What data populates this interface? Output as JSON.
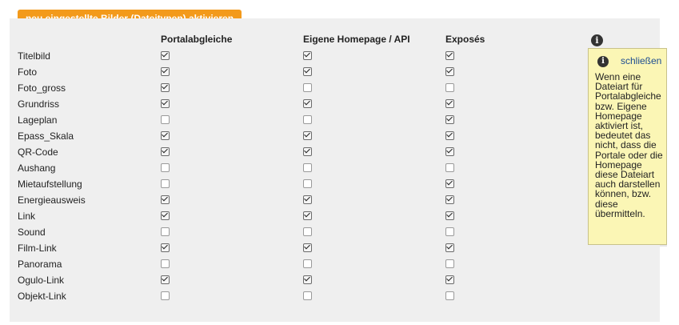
{
  "tab": {
    "label": "neu eingestellte Bilder (Dateitypen) aktivieren"
  },
  "columns": [
    "Portalabgleiche",
    "Eigene Homepage / API",
    "Exposés"
  ],
  "rows": [
    {
      "label": "Titelbild",
      "values": [
        true,
        true,
        true
      ]
    },
    {
      "label": "Foto",
      "values": [
        true,
        true,
        true
      ]
    },
    {
      "label": "Foto_gross",
      "values": [
        true,
        false,
        false
      ]
    },
    {
      "label": "Grundriss",
      "values": [
        true,
        true,
        true
      ]
    },
    {
      "label": "Lageplan",
      "values": [
        false,
        false,
        true
      ]
    },
    {
      "label": "Epass_Skala",
      "values": [
        true,
        true,
        true
      ]
    },
    {
      "label": "QR-Code",
      "values": [
        true,
        true,
        true
      ]
    },
    {
      "label": "Aushang",
      "values": [
        false,
        false,
        false
      ]
    },
    {
      "label": "Mietaufstellung",
      "values": [
        false,
        false,
        true
      ]
    },
    {
      "label": "Energieausweis",
      "values": [
        true,
        true,
        true
      ]
    },
    {
      "label": "Link",
      "values": [
        true,
        true,
        true
      ]
    },
    {
      "label": "Sound",
      "values": [
        false,
        false,
        false
      ]
    },
    {
      "label": "Film-Link",
      "values": [
        true,
        true,
        true
      ]
    },
    {
      "label": "Panorama",
      "values": [
        false,
        false,
        false
      ]
    },
    {
      "label": "Ogulo-Link",
      "values": [
        true,
        true,
        true
      ]
    },
    {
      "label": "Objekt-Link",
      "values": [
        false,
        false,
        false
      ]
    }
  ],
  "info": {
    "icon": "info-icon"
  },
  "tooltip": {
    "close_label": "schließen",
    "text": "Wenn eine Dateiart für Portalabgleiche bzw. Eigene Homepage aktiviert ist, bedeutet das nicht, dass die Portale oder die Homepage diese Dateiart auch darstellen können, bzw. diese übermitteln."
  },
  "colors": {
    "tab": "#f39a1b",
    "panel": "#efefef",
    "tooltip_bg": "#fbf6b5",
    "link": "#1c4c91"
  }
}
